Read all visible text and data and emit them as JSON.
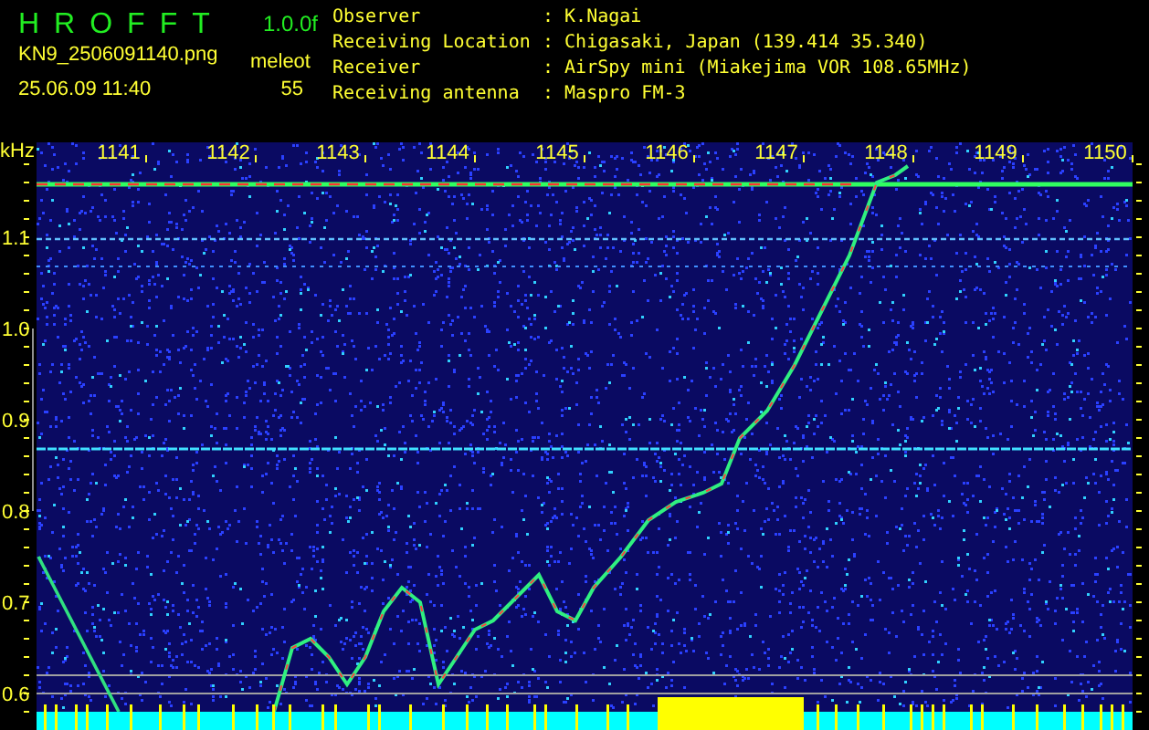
{
  "app": {
    "name": "HROFFT",
    "version": "1.0.0f",
    "file": "KN9_2506091140.png",
    "mode": "meleot",
    "date_time": "25.06.09 11:40",
    "count": "55"
  },
  "station": [
    {
      "label": "Observer",
      "value": ": K.Nagai"
    },
    {
      "label": "Receiving Location",
      "value": ": Chigasaki, Japan (139.414 35.340)"
    },
    {
      "label": "Receiver",
      "value": ": AirSpy mini (Miakejima VOR 108.65MHz)"
    },
    {
      "label": "Receiving antenna",
      "value": ": Maspro FM-3"
    }
  ],
  "plot": {
    "y_unit": "kHz",
    "x_labels": [
      "1141",
      "1142",
      "1143",
      "1144",
      "1145",
      "1146",
      "1147",
      "1148",
      "1149",
      "1150"
    ],
    "y_labels": [
      "1.1",
      "1.0",
      "0.9",
      "0.8",
      "0.7",
      "0.6"
    ]
  }
}
